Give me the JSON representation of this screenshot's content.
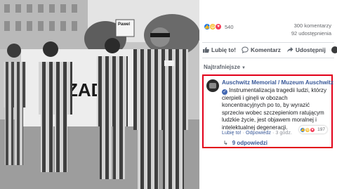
{
  "post": {
    "reaction_count": "540",
    "comments_count": "300 komentarzy",
    "shares_count": "92 udostępnienia"
  },
  "actions": {
    "like": "Lubię to!",
    "comment": "Komentarz",
    "share": "Udostępnij"
  },
  "sort": {
    "label": "Najtrafniejsze"
  },
  "photo": {
    "sign_text": "Pawel"
  },
  "comment": {
    "author": "Auschwitz Memorial / Muzeum Auschwitz",
    "text": "Instrumentalizacja tragedii ludzi, którzy cierpieli i ginęli w obozach koncentracyjnych po to, by wyrazić sprzeciw wobec szczepieniom ratującym ludzkie życie, jest objawem moralnej i intelektualnej degeneracji.",
    "like": "Lubię to!",
    "reply": "Odpowiedz",
    "time": "3 godz.",
    "reaction_count": "197",
    "replies": "9 odpowiedzi"
  },
  "colors": {
    "highlight_border": "#e2001a",
    "link": "#385898",
    "like_blue": "#1877f2"
  },
  "icons": [
    "like-icon",
    "haha-icon",
    "love-icon",
    "comment-icon",
    "share-icon",
    "verified-icon",
    "reply-arrow-icon",
    "chevron-down-icon"
  ]
}
